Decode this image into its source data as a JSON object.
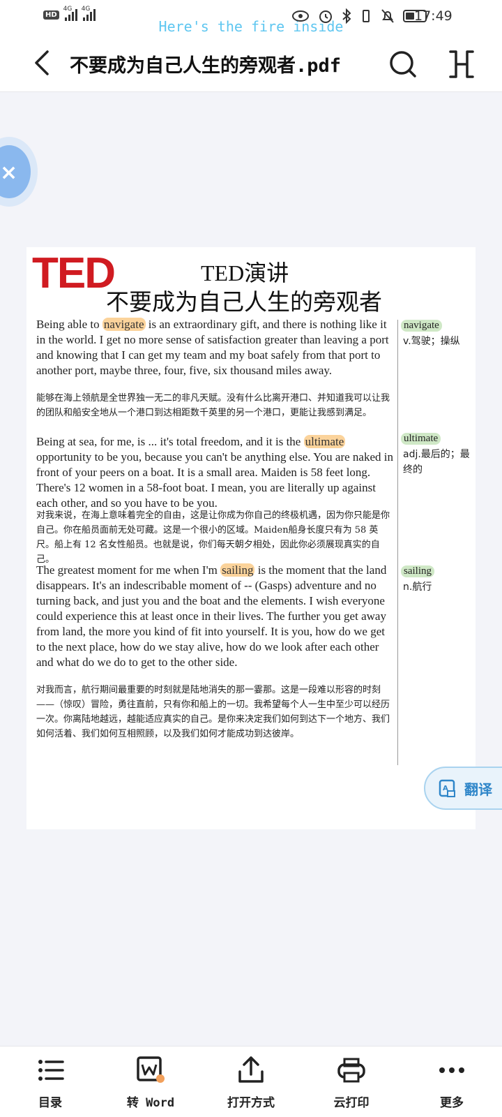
{
  "status_bar": {
    "hd_label": "HD",
    "net1": "4G",
    "net2": "4G",
    "banner": "Here's the fire inside",
    "time": "17:49"
  },
  "header": {
    "title": "不要成为自己人生的旁观者.pdf"
  },
  "document": {
    "logo": "TED",
    "subtitle": "TED演讲",
    "title": "不要成为自己人生的旁观者",
    "p1": {
      "before": "Being able to ",
      "keyword": "navigate",
      "after": " is an extraordinary gift, and there is nothing like it in the world. I get no more sense of satisfaction greater than leaving a port and knowing that I can get my team and my boat safely from that port to another port, maybe three, four, five, six thousand miles away.",
      "zh": "能够在海上领航是全世界独一无二的非凡天赋。没有什么比离开港口、并知道我可以让我的团队和船安全地从一个港口到达相距数千英里的另一个港口，更能让我感到满足。"
    },
    "p2": {
      "before": "Being at sea, for me, is ... it's total freedom, and it is the ",
      "keyword": "ultimate",
      "after": " opportunity to be you, because you can't be anything else. You are naked in front of your peers on a boat. It is a small area. Maiden is 58 feet long. There's 12 women in a 58-foot boat. I mean, you are literally up against each other, and so you have to be you.",
      "zh": "对我来说，在海上意味着完全的自由，这是让你成为你自己的终极机遇，因为你只能是你自己。你在船员面前无处可藏。这是一个很小的区域。Maiden船身长度只有为 58 英尺。船上有 12 名女性船员。也就是说，你们每天朝夕相处，因此你必须展现真实的自己。"
    },
    "p3": {
      "before": "The greatest moment for me when I'm ",
      "keyword": "sailing",
      "after": " is the moment that the land disappears. It's an indescribable moment of -- (Gasps) adventure and no turning back, and just you and the boat and the elements. I wish everyone could experience this at least once in their lives. The further you get away from land, the more you kind of fit into yourself. It is you, how do we get to the next place, how do we stay alive, how do we look after each other and what do we do to get to the other side.",
      "zh": "对我而言，航行期间最重要的时刻就是陆地消失的那一霎那。这是一段难以形容的时刻——（惊叹）冒险，勇往直前，只有你和船上的一切。我希望每个人一生中至少可以经历一次。你离陆地越远，越能适应真实的自己。是你来决定我们如何到达下一个地方、我们如何活着、我们如何互相照顾，以及我们如何才能成功到达彼岸。"
    },
    "glossary": [
      {
        "word": "navigate",
        "definition": "v.驾驶；操纵"
      },
      {
        "word": "ultimate",
        "definition": "adj.最后的；最终的"
      },
      {
        "word": "sailing",
        "definition": "n.航行"
      }
    ]
  },
  "translate_button": {
    "label": "翻译"
  },
  "bottom_bar": {
    "tabs": [
      {
        "label": "目录",
        "icon": "list-icon"
      },
      {
        "label": "转 Word",
        "icon": "convert-word-icon"
      },
      {
        "label": "打开方式",
        "icon": "share-open-icon"
      },
      {
        "label": "云打印",
        "icon": "printer-icon"
      },
      {
        "label": "更多",
        "icon": "more-icon"
      }
    ]
  },
  "colors": {
    "ted_red": "#d01b21",
    "highlight": "#fbd39b",
    "gloss_tag": "#cfe8c6",
    "translate_blue": "#2f86c9",
    "banner_cyan": "#5ec6f0"
  }
}
